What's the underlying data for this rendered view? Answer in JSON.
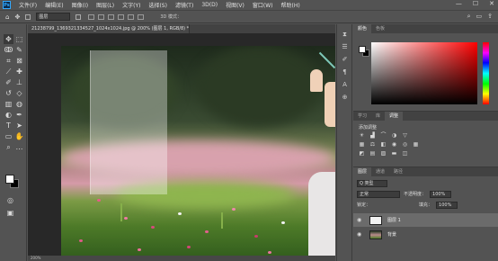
{
  "menubar": {
    "logo": "Ps",
    "items": [
      "文件(F)",
      "编辑(E)",
      "图像(I)",
      "图层(L)",
      "文字(Y)",
      "选择(S)",
      "滤镜(T)",
      "3D(D)",
      "视图(V)",
      "窗口(W)",
      "帮助(H)"
    ],
    "window_controls": [
      "—",
      "☐",
      "✕"
    ]
  },
  "optbar": {
    "move_icon": "move-icon",
    "select_value": "图层",
    "mode_3d_label": "3D 模式："
  },
  "document": {
    "tab_label": "21238799_136932133452​7_1024x1024.jpg @ 200% (图层 1, RGB/8) *",
    "status": "200%"
  },
  "color_panel": {
    "tabs": [
      "颜色",
      "色板"
    ],
    "foreground": "#ffffff",
    "background": "#000000"
  },
  "adjust_panel": {
    "tabs": [
      "学习",
      "库",
      "调整"
    ],
    "title": "添加调整"
  },
  "layers_panel": {
    "tabs": [
      "图层",
      "通道",
      "路径"
    ],
    "filter_label": "Q 类型",
    "blend_mode": "正常",
    "opacity_label": "不透明度：",
    "opacity_value": "100%",
    "lock_label": "锁定：",
    "fill_label": "填充：",
    "fill_value": "100%",
    "layers": [
      {
        "name": "图层 1",
        "selected": true
      },
      {
        "name": "背景",
        "selected": false
      }
    ]
  }
}
